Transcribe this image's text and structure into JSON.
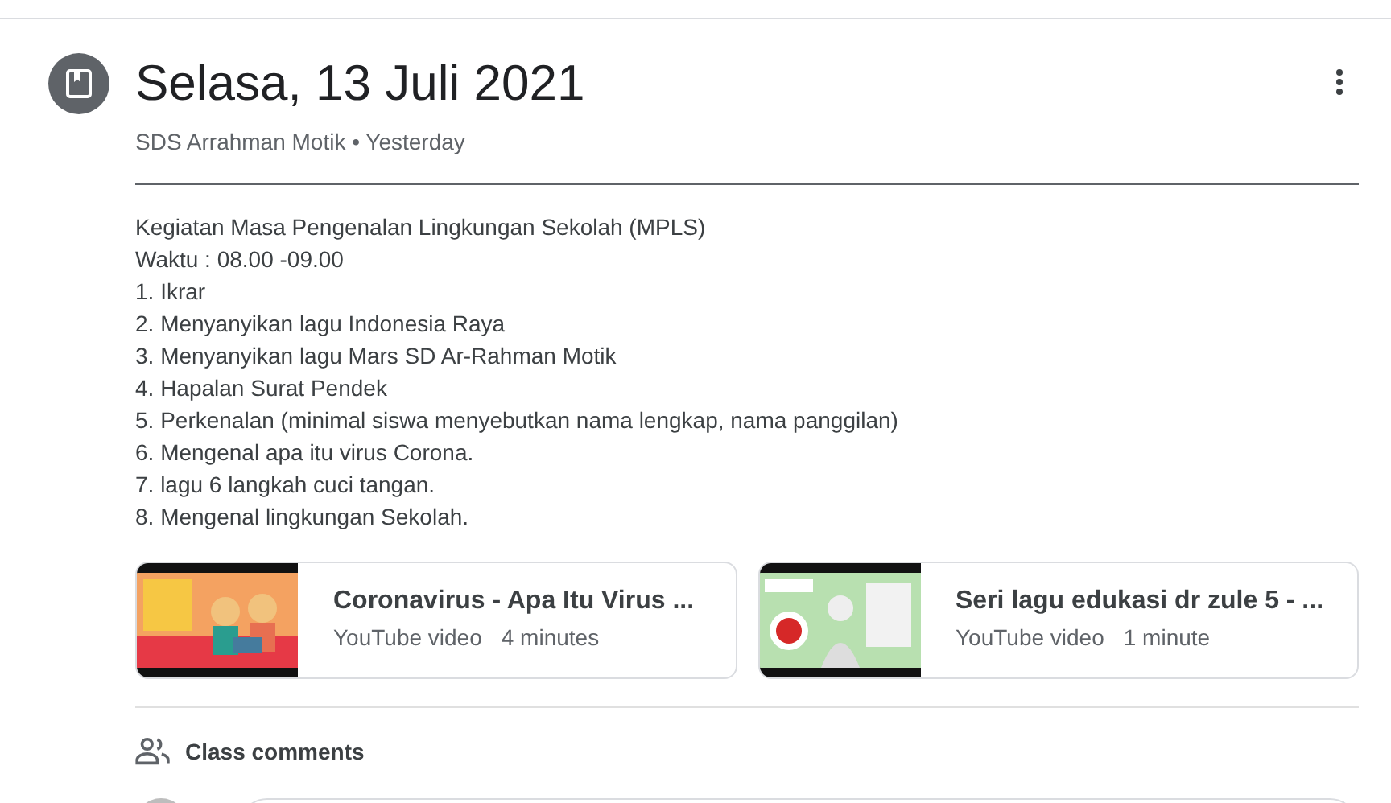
{
  "post": {
    "title": "Selasa, 13 Juli 2021",
    "meta": "SDS Arrahman Motik • Yesterday"
  },
  "body": [
    "Kegiatan Masa Pengenalan Lingkungan Sekolah (MPLS)",
    "Waktu : 08.00 -09.00",
    "1. Ikrar",
    "2. Menyanyikan lagu Indonesia Raya",
    "3. Menyanyikan lagu Mars SD Ar-Rahman Motik",
    "4. Hapalan Surat Pendek",
    "5. Perkenalan (minimal siswa menyebutkan nama lengkap, nama panggilan)",
    "6. Mengenal apa itu virus Corona.",
    "7. lagu 6 langkah cuci tangan.",
    "8. Mengenal lingkungan Sekolah."
  ],
  "attachments": [
    {
      "title": "Coronavirus - Apa Itu Virus ...",
      "type": "YouTube video",
      "duration": "4 minutes",
      "kind": "picture"
    },
    {
      "title": "Seri lagu edukasi dr zule 5 - ...",
      "type": "YouTube video",
      "duration": "1 minute",
      "kind": "picture"
    }
  ],
  "comments": {
    "label": "Class comments"
  }
}
